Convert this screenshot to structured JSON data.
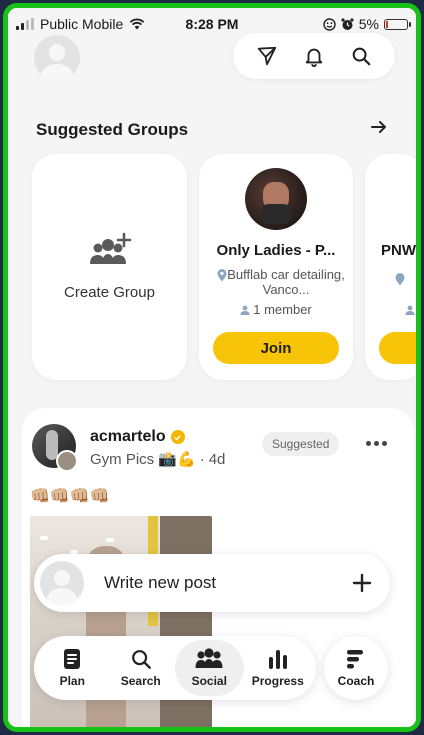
{
  "status_bar": {
    "carrier": "Public Mobile",
    "time": "8:28 PM",
    "battery": "5%"
  },
  "header": {
    "icons": [
      "send-icon",
      "bell-icon",
      "search-icon"
    ]
  },
  "suggested_groups": {
    "title": "Suggested Groups",
    "create_label": "Create Group",
    "groups": [
      {
        "name": "Only Ladies - P...",
        "location": "Bufflab car detailing, Vanco...",
        "members": "1 member",
        "join_label": "Join"
      },
      {
        "name": "PNW"
      }
    ]
  },
  "post": {
    "username": "acmartelo",
    "group": "Gym Pics 📸💪",
    "time": "4d",
    "badge": "Suggested",
    "content": "👊🏼👊🏼👊🏼👊🏼"
  },
  "compose": {
    "label": "Write new post"
  },
  "nav": {
    "items": [
      {
        "label": "Plan",
        "icon": "plan-icon"
      },
      {
        "label": "Search",
        "icon": "search-icon"
      },
      {
        "label": "Social",
        "icon": "social-icon",
        "active": true
      },
      {
        "label": "Progress",
        "icon": "progress-icon"
      }
    ],
    "coach_label": "Coach"
  },
  "colors": {
    "accent": "#f8c408",
    "frame": "#19c219",
    "background": "#f5f5f5"
  }
}
